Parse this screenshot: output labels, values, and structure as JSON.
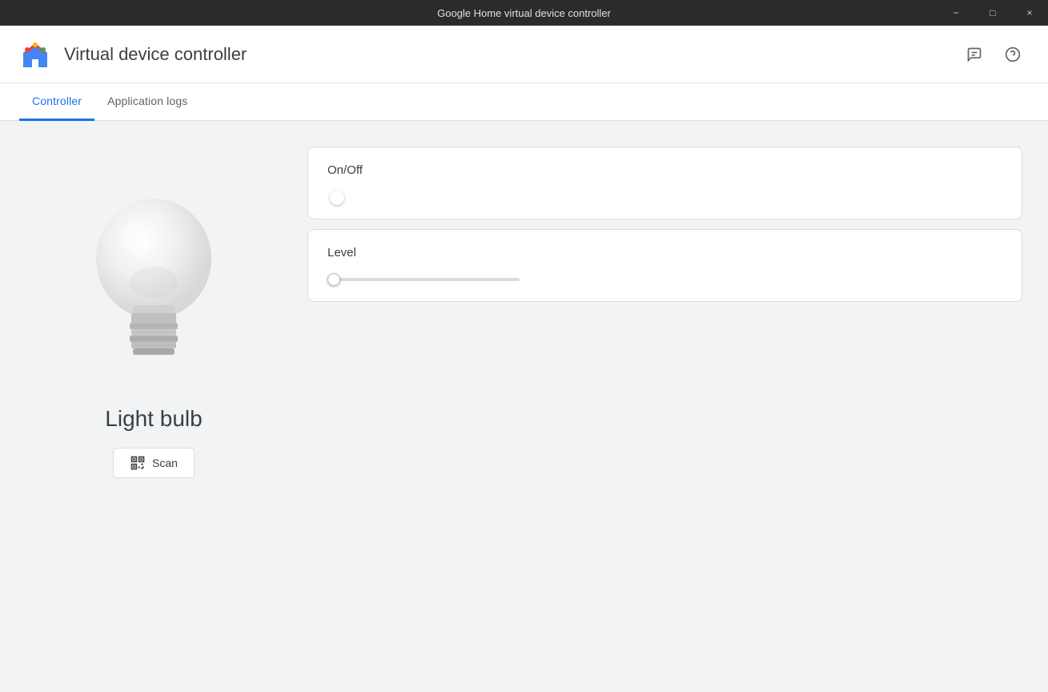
{
  "titlebar": {
    "title": "Google Home virtual device controller",
    "minimize_label": "−",
    "maximize_label": "□",
    "close_label": "×"
  },
  "header": {
    "app_title": "Virtual device controller",
    "chat_icon": "💬",
    "help_icon": "?"
  },
  "tabs": [
    {
      "id": "controller",
      "label": "Controller",
      "active": true
    },
    {
      "id": "application-logs",
      "label": "Application logs",
      "active": false
    }
  ],
  "left_panel": {
    "device_name": "Light bulb",
    "scan_button_label": "Scan"
  },
  "controls": [
    {
      "id": "on-off",
      "label": "On/Off",
      "type": "toggle",
      "value": false
    },
    {
      "id": "level",
      "label": "Level",
      "type": "slider",
      "value": 0,
      "min": 0,
      "max": 100
    }
  ]
}
